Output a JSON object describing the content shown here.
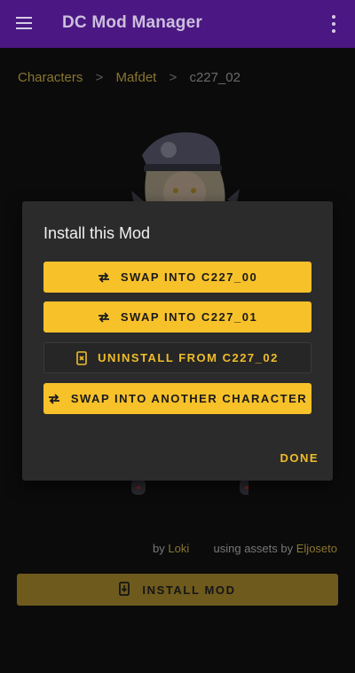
{
  "app": {
    "title": "DC Mod Manager"
  },
  "breadcrumb": {
    "items": [
      "Characters",
      "Mafdet",
      "c227_02"
    ],
    "separator": ">"
  },
  "credits": {
    "by_prefix": "by",
    "author": "Loki",
    "assets_prefix": "using assets by",
    "assets_author": "Eljoseto"
  },
  "install": {
    "label": "INSTALL MOD"
  },
  "dialog": {
    "title": "Install this Mod",
    "buttons": [
      {
        "label": "SWAP INTO C227_00",
        "icon": "swap-icon"
      },
      {
        "label": "SWAP INTO C227_01",
        "icon": "swap-icon"
      },
      {
        "label": "UNINSTALL FROM C227_02",
        "icon": "uninstall-icon"
      },
      {
        "label": "SWAP INTO ANOTHER CHARACTER",
        "icon": "swap-icon"
      }
    ],
    "done_label": "DONE"
  },
  "colors": {
    "appbar": "#4a1783",
    "accent": "#f7c12a",
    "dialog_bg": "#2b2b2b"
  }
}
